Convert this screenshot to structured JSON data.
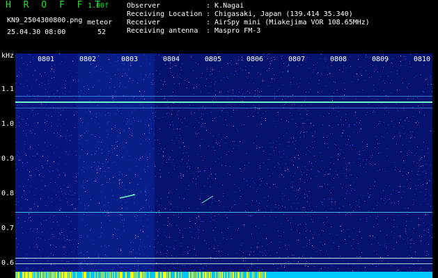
{
  "header": {
    "app_title": "H R O F F T",
    "version": "1.00f",
    "filename": "KN9_2504300800.png",
    "datetime": "25.04.30 08:00",
    "method_label": "meteor",
    "method_value": "52"
  },
  "info": [
    {
      "label": "Observer",
      "value": ": K.Nagai"
    },
    {
      "label": "Receiving Location",
      "value": ": Chigasaki, Japan (139.414 35.340)"
    },
    {
      "label": "Receiver",
      "value": ": AirSpy mini (Miakejima VOR 108.65MHz)"
    },
    {
      "label": "Receiving antenna",
      "value": ": Maspro FM-3"
    }
  ],
  "spectrogram": {
    "y_unit": "kHz",
    "y_ticks": [
      "1.1",
      "1.0",
      "0.9",
      "0.8",
      "0.7",
      "0.6"
    ],
    "x_ticks": [
      "0801",
      "0802",
      "0803",
      "0804",
      "0805",
      "0806",
      "0807",
      "0808",
      "0809",
      "0810"
    ],
    "colors": {
      "background": "#06126e",
      "noise": "#2f64ff",
      "signal": "#6effc8",
      "bottom_bar": "#00c8ff",
      "marks": "#ffff00"
    }
  }
}
